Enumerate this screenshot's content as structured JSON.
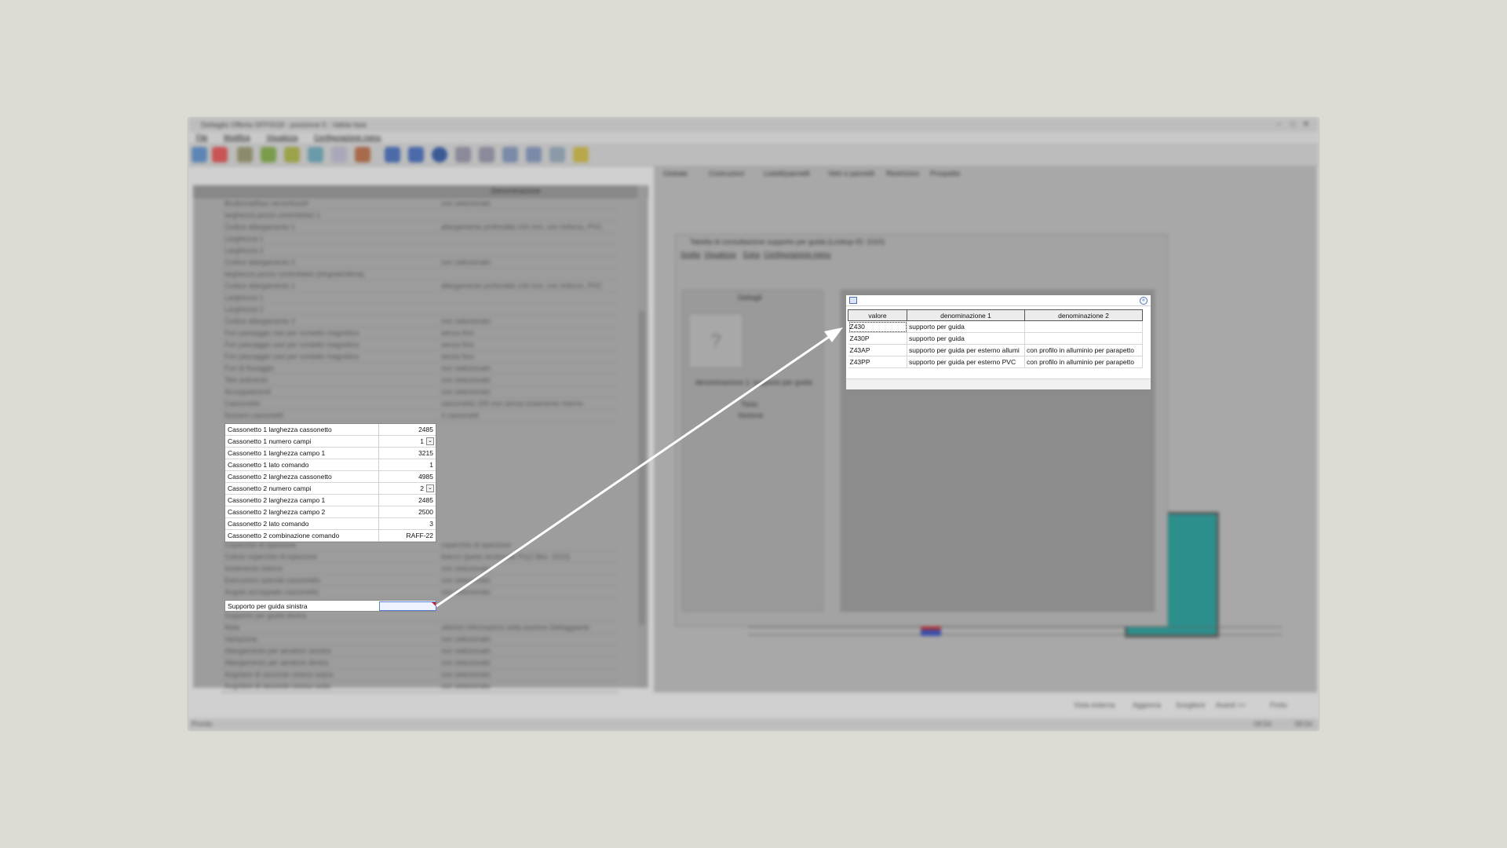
{
  "window": {
    "title": "Dettaglio Offerta OFF0018 - posizione 5 - Valida fase",
    "minimize": "–",
    "maximize": "□",
    "close": "✕"
  },
  "menubar": [
    "File",
    "Modifica",
    "Visualizza",
    "Configurazione menu"
  ],
  "toolbar_icons": [
    "circle-blue-icon",
    "circle-red-icon",
    "tool-icon",
    "tool-icon",
    "tool-icon",
    "tool-icon",
    "tool-icon",
    "tool-icon",
    "first-icon",
    "prev-icon",
    "dot-icon",
    "next-icon",
    "last-icon",
    "grid-icon",
    "grid-icon",
    "grid-icon",
    "pin-icon"
  ],
  "left_table": {
    "header_denominazione": "Denominazione",
    "blur_rows": [
      {
        "a": "Bruttomaßbau verschlussfr",
        "b": "non selezionato"
      },
      {
        "a": "larghezza pezzo controtelaio 1",
        "b": ""
      },
      {
        "a": "Codice allargamento 1",
        "b": "allargamento profondità 144 mm, con rinforzo, PVC"
      },
      {
        "a": "Larghezza 1",
        "b": ""
      },
      {
        "a": "Larghezza 2",
        "b": ""
      },
      {
        "a": "Codice allargamento 2",
        "b": "non selezionato"
      },
      {
        "a": "larghezza pezzo controtelaio (singola/ultima)",
        "b": ""
      },
      {
        "a": "Codice allargamento 1",
        "b": "allargamento profondità 144 mm, con rinforzo, PVC"
      },
      {
        "a": "Larghezza 1",
        "b": ""
      },
      {
        "a": "Larghezza 2",
        "b": ""
      },
      {
        "a": "Codice allargamento 2",
        "b": "non selezionato"
      },
      {
        "a": "Fori passaggio cavi per contatto magnetico",
        "b": "senza foro"
      },
      {
        "a": "Fori passaggio cavi per contatto magnetico",
        "b": "senza foro"
      },
      {
        "a": "Fori passaggio cavi per contatto magnetico",
        "b": "senza foro"
      },
      {
        "a": "Fori di fissaggio",
        "b": "non selezionato"
      },
      {
        "a": "Telo antivento",
        "b": "non selezionato"
      },
      {
        "a": "Accoppiamenti",
        "b": "non selezionato"
      },
      {
        "a": "Cassonetto",
        "b": "cassonetto 205 mm senza isolamento interno"
      },
      {
        "a": "Numero cassonetti",
        "b": "2 cassonetti"
      }
    ],
    "blur_rows_after": [
      {
        "a": "Coperchio di ispezione",
        "b": "coperchio di ispezione"
      },
      {
        "a": "Colore coperchio di ispezione",
        "b": "bianco (parte strutturale P112 Bez. 1010)"
      },
      {
        "a": "Isolamento interno",
        "b": "non selezionato"
      },
      {
        "a": "Esecuzioni speciali cassonetto",
        "b": "non selezionato"
      },
      {
        "a": "Angolo accoppiato cassonetto",
        "b": "non selezionato"
      }
    ],
    "blur_rows_tail": [
      {
        "a": "Supporto per guida destra",
        "b": ""
      },
      {
        "a": "Nota",
        "b": "ulteriori informazioni nella sezione Dettaggiante"
      },
      {
        "a": "Variazione",
        "b": "non selezionato"
      },
      {
        "a": "Allargamento per aeratore sinistra",
        "b": "non selezionato"
      },
      {
        "a": "Allargamento per aeratore destra",
        "b": "non selezionato"
      },
      {
        "a": "Angolare di raccordo cinisco sopra",
        "b": "non selezionato"
      },
      {
        "a": "Angolare di raccordo cinisco sotto",
        "b": "non selezionato"
      }
    ]
  },
  "highlighted_rows": [
    {
      "label": "Cassonetto 1 larghezza cassonetto",
      "value": "2485",
      "dropdown": false
    },
    {
      "label": "Cassonetto 1 numero campi",
      "value": "1",
      "dropdown": true
    },
    {
      "label": "Cassonetto 1 larghezza campo 1",
      "value": "3215",
      "dropdown": false
    },
    {
      "label": "Cassonetto 1 lato comando",
      "value": "1",
      "dropdown": false
    },
    {
      "label": "Cassonetto 2 larghezza cassonetto",
      "value": "4985",
      "dropdown": false
    },
    {
      "label": "Cassonetto 2 numero campi",
      "value": "2",
      "dropdown": true
    },
    {
      "label": "Cassonetto 2 larghezza campo 1",
      "value": "2485",
      "dropdown": false
    },
    {
      "label": "Cassonetto 2 larghezza campo 2",
      "value": "2500",
      "dropdown": false
    },
    {
      "label": "Cassonetto 2 lato comando",
      "value": "3",
      "dropdown": false
    },
    {
      "label": "Cassonetto 2 combinazione comando",
      "value": "RAFF-22",
      "dropdown": false
    }
  ],
  "support_row": {
    "label": "Supporto per guida sinistra",
    "value": ""
  },
  "right_tabs": [
    "Globale",
    "Costruzioni",
    "Listelli/pannelli",
    "Vetri e pannelli",
    "Restrizioni",
    "Prospetto"
  ],
  "dialog": {
    "title": "Tabella di consultazione supporto per guida (Lookup-ID: 1010)",
    "menu": [
      "Scelta",
      "Visualizza",
      "Extra",
      "Configurazione menu"
    ],
    "side_title": "Dettagli",
    "side_desc": "denominazione 1: supporto per guida",
    "side_items": [
      "Titolo",
      "Sezione"
    ],
    "placeholder_glyph": "?"
  },
  "lookup": {
    "columns": [
      "valore",
      "denominazione 1",
      "denominazione 2"
    ],
    "rows": [
      {
        "valore": "Z430",
        "d1": "supporto per guida",
        "d2": ""
      },
      {
        "valore": "Z430P",
        "d1": "supporto per guida",
        "d2": ""
      },
      {
        "valore": "Z43AP",
        "d1": "supporto per guida per esterno allumi",
        "d2": "con profilo in alluminio per parapetto"
      },
      {
        "valore": "Z43PP",
        "d1": "supporto per guida per esterno PVC",
        "d2": "con profilo in alluminio per parapetto"
      }
    ],
    "selected_index": 0,
    "collapse_glyph": "«"
  },
  "bottom_buttons": [
    "Vista esterna",
    "Aggiorna",
    "Scegliere",
    "Avanti >>",
    "Finito"
  ],
  "status": {
    "left": "Pronto",
    "right1": "09:54",
    "right2": "58:54"
  },
  "colors": {
    "accent": "#2c8f8c",
    "selection_border": "#5a7fd6",
    "marker_red": "#d02020"
  }
}
